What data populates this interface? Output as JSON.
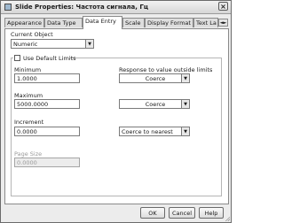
{
  "window": {
    "title": "Slide Properties: Частота сигнала, Гц",
    "close_glyph": "×"
  },
  "tabs": [
    {
      "label": "Appearance"
    },
    {
      "label": "Data Type"
    },
    {
      "label": "Data Entry",
      "active": true
    },
    {
      "label": "Scale"
    },
    {
      "label": "Display Format"
    },
    {
      "label": "Text La"
    }
  ],
  "tab_scroll_glyph": "◄►",
  "current_object": {
    "label": "Current Object",
    "value": "Numeric",
    "arrow": "▼"
  },
  "limits_group": {
    "checkbox_label": "Use Default Limits",
    "checked": false,
    "minimum_label": "Minimum",
    "minimum_value": "1.0000",
    "response_label": "Response to value outside limits",
    "minimum_response": "Coerce",
    "maximum_label": "Maximum",
    "maximum_value": "5000.0000",
    "maximum_response": "Coerce",
    "increment_label": "Increment",
    "increment_value": "0.0000",
    "increment_response": "Coerce to nearest",
    "page_size_label": "Page Size",
    "page_size_value": "0.0000",
    "arrow": "▼"
  },
  "footer": {
    "ok_label": "OK",
    "cancel_label": "Cancel",
    "help_label": "Help"
  }
}
